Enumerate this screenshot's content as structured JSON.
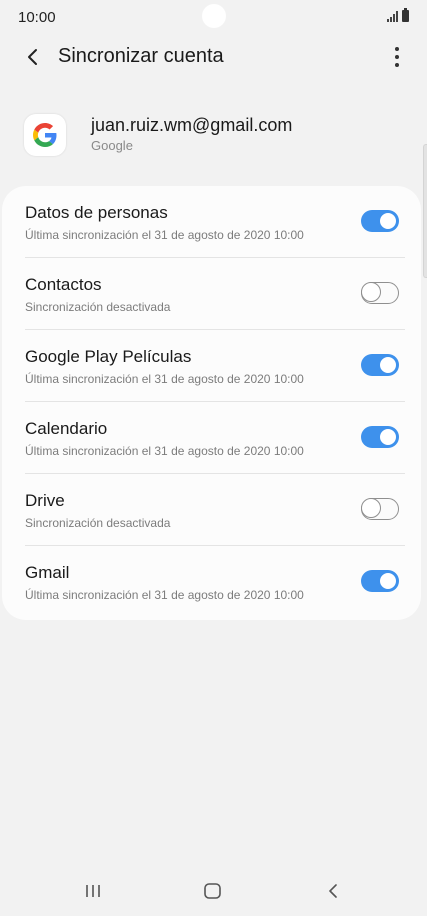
{
  "status_bar": {
    "time": "10:00"
  },
  "header": {
    "title": "Sincronizar cuenta"
  },
  "account": {
    "email": "juan.ruiz.wm@gmail.com",
    "provider": "Google"
  },
  "sync_items": [
    {
      "title": "Datos de personas",
      "subtitle": "Última sincronización el 31 de agosto de 2020 10:00",
      "enabled": true
    },
    {
      "title": "Contactos",
      "subtitle": "Sincronización desactivada",
      "enabled": false
    },
    {
      "title": "Google Play Películas",
      "subtitle": "Última sincronización el 31 de agosto de 2020 10:00",
      "enabled": true
    },
    {
      "title": "Calendario",
      "subtitle": "Última sincronización el 31 de agosto de 2020 10:00",
      "enabled": true
    },
    {
      "title": "Drive",
      "subtitle": "Sincronización desactivada",
      "enabled": false
    },
    {
      "title": "Gmail",
      "subtitle": "Última sincronización el 31 de agosto de 2020 10:00",
      "enabled": true
    }
  ],
  "icons": {
    "back": "back-arrow-icon",
    "more": "more-vert-icon",
    "logo": "google-logo-icon",
    "nav": [
      "recents-icon",
      "home-icon",
      "nav-back-icon"
    ]
  },
  "colors": {
    "accent": "#3e91ec",
    "background": "#f2f2f2",
    "card": "#fcfcfc"
  }
}
